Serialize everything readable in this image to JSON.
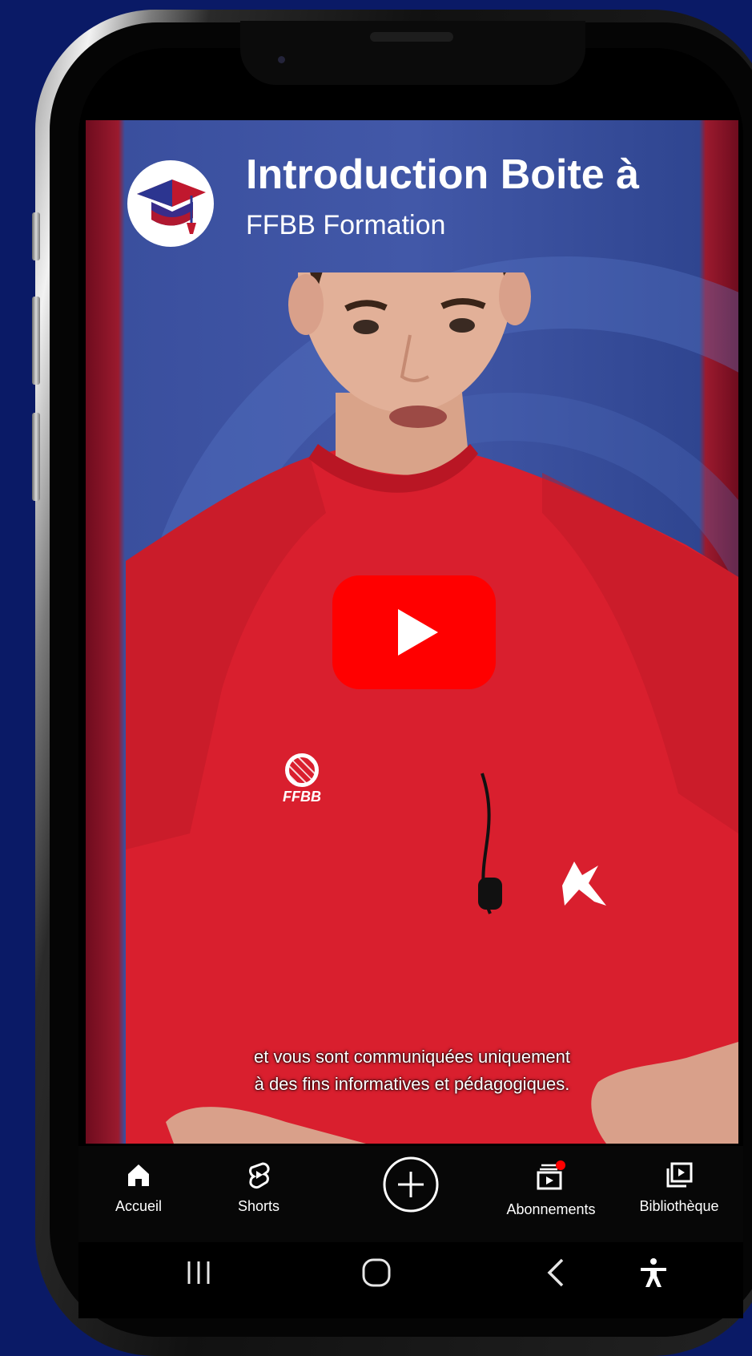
{
  "video": {
    "title": "Introduction Boite à",
    "channel": "FFBB Formation",
    "caption_line1": "et vous sont communiquées uniquement",
    "caption_line2": "à des fins informatives et pédagogiques.",
    "shirt_logo_text": "FFBB"
  },
  "nav": {
    "home": "Accueil",
    "shorts": "Shorts",
    "subscriptions": "Abonnements",
    "library": "Bibliothèque",
    "icons": [
      "home-icon",
      "shorts-icon",
      "create-icon",
      "subscriptions-icon",
      "library-icon"
    ]
  },
  "system_nav": {
    "icons": [
      "recents-icon",
      "home-nav-icon",
      "back-icon",
      "accessibility-icon"
    ]
  },
  "colors": {
    "page_background": "#0a1a66",
    "play_button": "#ff0000",
    "shirt": "#d91f2e",
    "notification_dot": "#ff0000"
  }
}
